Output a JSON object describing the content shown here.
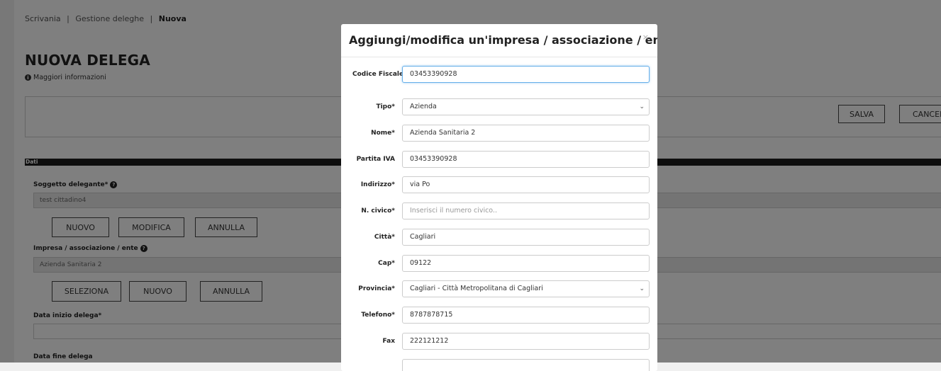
{
  "breadcrumb": {
    "item1": "Scrivania",
    "sep": "|",
    "item2": "Gestione deleghe",
    "current": "Nuova"
  },
  "page": {
    "title": "NUOVA DELEGA",
    "info_link": "Maggiori informazioni",
    "save_label": "SALVA",
    "cancel_label": "CANCEL",
    "section_title": "Dati"
  },
  "form": {
    "delegante_label": "Soggetto delegante*",
    "delegante_value": "test cittadino4",
    "delegante_buttons": {
      "new": "NUOVO",
      "edit": "MODIFICA",
      "cancel": "ANNULLA"
    },
    "impresa_label": "Impresa / associazione / ente",
    "impresa_value": "Azienda Sanitaria 2",
    "impresa_buttons": {
      "select": "SELEZIONA",
      "new": "NUOVO",
      "cancel": "ANNULLA"
    },
    "data_inizio_label": "Data inizio delega*",
    "data_fine_label": "Data fine delega"
  },
  "modal": {
    "title": "Aggiungi/modifica un'impresa / associazione / ente",
    "close": "×",
    "fields": {
      "codice_fiscale": {
        "label": "Codice Fiscale*",
        "value": "03453390928"
      },
      "tipo": {
        "label": "Tipo*",
        "value": "Azienda"
      },
      "nome": {
        "label": "Nome*",
        "value": "Azienda Sanitaria 2"
      },
      "partita_iva": {
        "label": "Partita IVA",
        "value": "03453390928"
      },
      "indirizzo": {
        "label": "Indirizzo*",
        "value": "via Po"
      },
      "civico": {
        "label": "N. civico*",
        "placeholder": "Inserisci il numero civico.."
      },
      "citta": {
        "label": "Città*",
        "value": "Cagliari"
      },
      "cap": {
        "label": "Cap*",
        "value": "09122"
      },
      "provincia": {
        "label": "Provincia*",
        "value": "Cagliari - Città Metropolitana di Cagliari"
      },
      "telefono": {
        "label": "Telefono*",
        "value": "8787878715"
      },
      "fax": {
        "label": "Fax",
        "value": "222121212"
      }
    }
  },
  "icons": {
    "info": "info-icon",
    "help": "question-icon",
    "chevron": "chevron-down-icon",
    "close": "close-icon"
  }
}
